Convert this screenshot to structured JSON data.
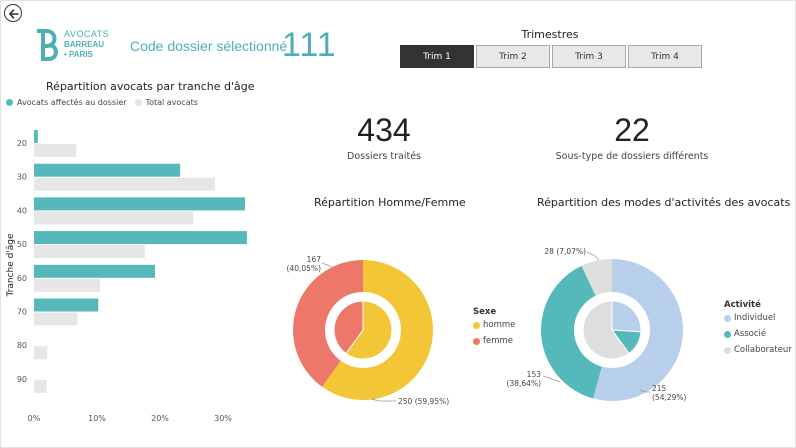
{
  "header": {
    "logo_line1": "AVOCATS",
    "logo_line2": "BARREAU",
    "logo_line3": "• PARIS",
    "code_label": "Code dossier sélectionné :",
    "code_value": "111"
  },
  "trimestres": {
    "title": "Trimestres",
    "tabs": [
      "Trim 1",
      "Trim 2",
      "Trim 3",
      "Trim 4"
    ],
    "active": 0
  },
  "kpis": [
    {
      "value": "434",
      "label": "Dossiers traités"
    },
    {
      "value": "22",
      "label": "Sous-type de dossiers différents"
    }
  ],
  "colors": {
    "teal": "#55b9bb",
    "light_gray": "#e6e6e6",
    "yellow": "#f2c637",
    "salmon": "#ed786a",
    "blue_light": "#b7cfea",
    "gray": "#dedede"
  },
  "chart_data": [
    {
      "type": "bar",
      "orientation": "horizontal",
      "title": "Répartition avocats par tranche d'âge",
      "ylabel": "Tranche d'âge",
      "categories": [
        "20",
        "30",
        "40",
        "50",
        "60",
        "70",
        "80",
        "90"
      ],
      "series": [
        {
          "name": "Avocats affectés au dossier",
          "color": "#55b9bb",
          "values": [
            0.6,
            23.2,
            33.5,
            33.8,
            19.2,
            10.2,
            0,
            0
          ]
        },
        {
          "name": "Total avocats",
          "color": "#e6e6e6",
          "values": [
            6.7,
            28.7,
            25.3,
            17.6,
            10.5,
            6.9,
            2.1,
            2.0
          ]
        }
      ],
      "xticks": [
        "0%",
        "10%",
        "20%",
        "30%"
      ],
      "xlim": [
        0,
        34
      ],
      "legend_position": "top-left",
      "grid": false
    },
    {
      "type": "pie",
      "title": "Répartition Homme/Femme",
      "legend_title": "Sexe",
      "slices": [
        {
          "name": "homme",
          "value": 250,
          "label": "250 (59,95%)",
          "color": "#f2c637"
        },
        {
          "name": "femme",
          "value": 167,
          "label": "167\n(40,05%)",
          "color": "#ed786a"
        }
      ],
      "inner_ring": [
        {
          "name": "homme",
          "value": 250
        },
        {
          "name": "femme",
          "value": 167
        }
      ]
    },
    {
      "type": "pie",
      "title": "Répartition des modes d'activités des avocats",
      "legend_title": "Activité",
      "slices": [
        {
          "name": "Individuel",
          "value": 215,
          "label": "215\n(54,29%)",
          "color": "#b7cfea"
        },
        {
          "name": "Associé",
          "value": 153,
          "label": "153\n(38,64%)",
          "color": "#55b9bb"
        },
        {
          "name": "Collaborateur",
          "value": 28,
          "label": "28 (7,07%)",
          "color": "#dedede"
        }
      ],
      "inner_ring": [
        {
          "name": "Individuel",
          "value": 26
        },
        {
          "name": "Associé",
          "value": 14
        },
        {
          "name": "Collaborateur",
          "value": 60
        }
      ]
    }
  ]
}
